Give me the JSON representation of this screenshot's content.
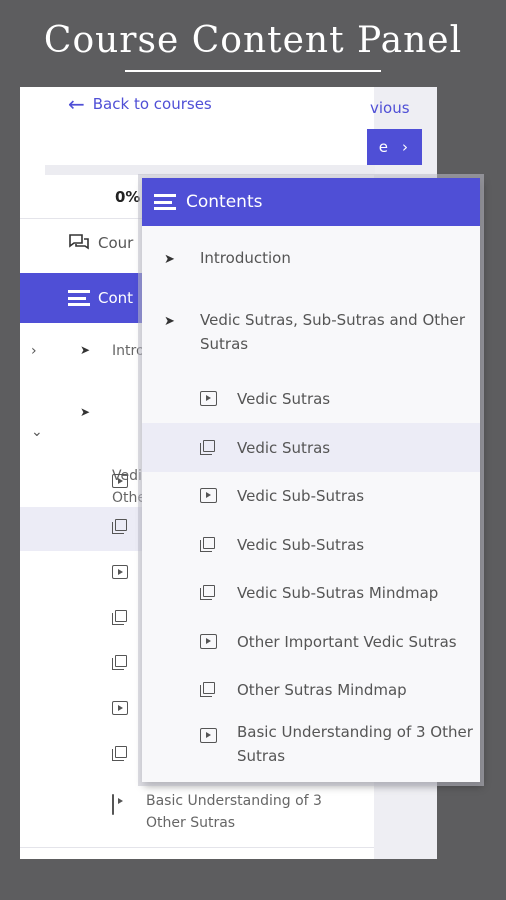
{
  "headline": "Course Content Panel",
  "back_screen": {
    "back_label": "Back to courses",
    "previous_label": "vious",
    "next_label": "e",
    "progress_percent": "0%",
    "course_tab_label": "Cour",
    "contents_tab_label": "Cont",
    "sections": [
      {
        "label": "Intro",
        "tag": "▶"
      },
      {
        "label": "Vedi\nOthe",
        "tag": "▶"
      }
    ],
    "last_item": "Basic Understanding of 3\nOther Sutras"
  },
  "panel": {
    "title": "Contents",
    "sections": [
      {
        "label": "Introduction"
      },
      {
        "label": "Vedic Sutras, Sub-Sutras and Other Sutras"
      }
    ],
    "items": [
      {
        "label": "Vedic Sutras",
        "icon": "video-icon"
      },
      {
        "label": "Vedic Sutras",
        "icon": "document-icon"
      },
      {
        "label": "Vedic Sub-Sutras",
        "icon": "video-icon"
      },
      {
        "label": "Vedic Sub-Sutras",
        "icon": "document-icon"
      },
      {
        "label": "Vedic Sub-Sutras Mindmap",
        "icon": "document-icon"
      },
      {
        "label": "Other Important Vedic Sutras",
        "icon": "video-icon"
      },
      {
        "label": "Other Sutras Mindmap",
        "icon": "document-icon"
      },
      {
        "label": "Basic Understanding of 3 Other Sutras",
        "icon": "video-icon"
      }
    ]
  },
  "colors": {
    "accent": "#4f4fd6",
    "background": "#5d5d5f",
    "highlight": "#ececf6"
  }
}
